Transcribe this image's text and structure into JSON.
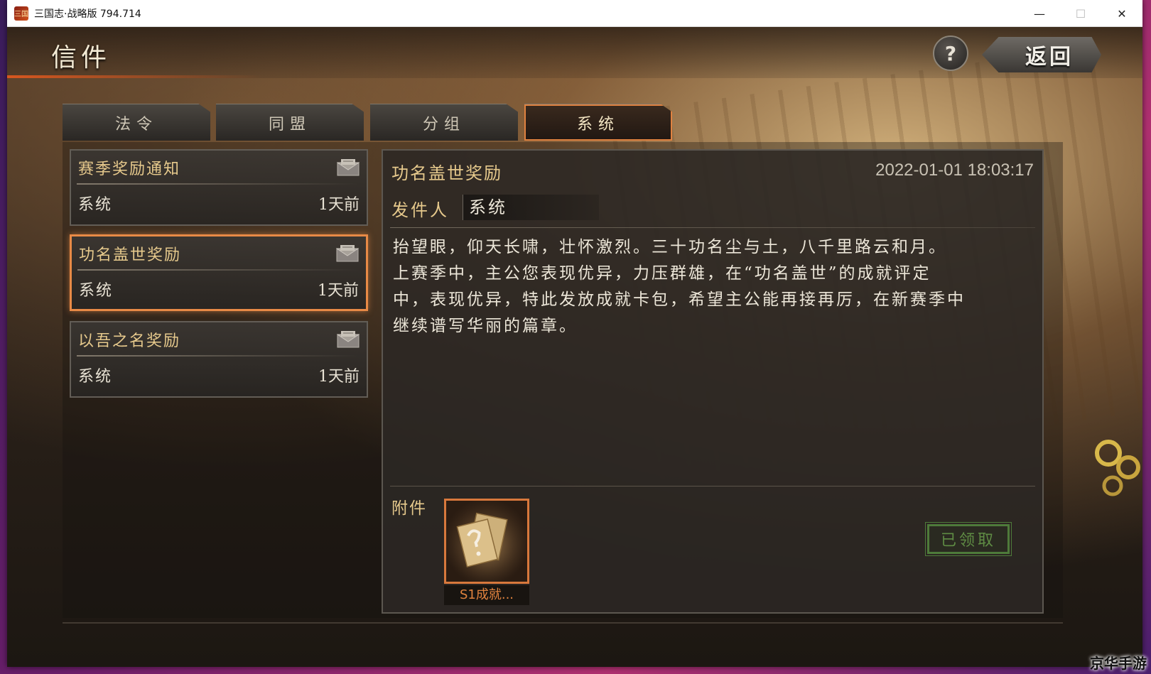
{
  "window": {
    "title": "三国志·战略版 794.714",
    "app_icon_text": "三国",
    "minimize_glyph": "—",
    "maximize_glyph": "☐",
    "close_glyph": "✕"
  },
  "header": {
    "title": "信件",
    "help_label": "?",
    "back_label": "返回"
  },
  "tabs": [
    {
      "label": "法令",
      "active": false
    },
    {
      "label": "同盟",
      "active": false
    },
    {
      "label": "分组",
      "active": false
    },
    {
      "label": "系统",
      "active": true
    }
  ],
  "mail_list": [
    {
      "title": "赛季奖励通知",
      "sender": "系统",
      "time": "1天前",
      "selected": false,
      "icon": "envelope-icon"
    },
    {
      "title": "功名盖世奖励",
      "sender": "系统",
      "time": "1天前",
      "selected": true,
      "icon": "envelope-icon"
    },
    {
      "title": "以吾之名奖励",
      "sender": "系统",
      "time": "1天前",
      "selected": false,
      "icon": "envelope-icon"
    }
  ],
  "detail": {
    "title": "功名盖世奖励",
    "date": "2022-01-01 18:03:17",
    "sender_label": "发件人",
    "sender_value": "系统",
    "body_lines": [
      "抬望眼，仰天长啸，壮怀激烈。三十功名尘与土，八千里路云和月。",
      "上赛季中，主公您表现优异，力压群雄，在“功名盖世”的成就评定",
      "中，表现优异，特此发放成就卡包，希望主公能再接再厉，在新赛季中",
      "继续谱写华丽的篇章。"
    ],
    "attachment_label": "附件",
    "attachment": {
      "caption": "S1成就...",
      "icon": "card-pack-icon",
      "glyph": "?"
    },
    "claimed_label": "已领取"
  },
  "watermark": "京华手游",
  "colors": {
    "accent_orange": "#e88a46",
    "title_gold": "#e6c98c",
    "claimed_green": "#5f8c44"
  }
}
